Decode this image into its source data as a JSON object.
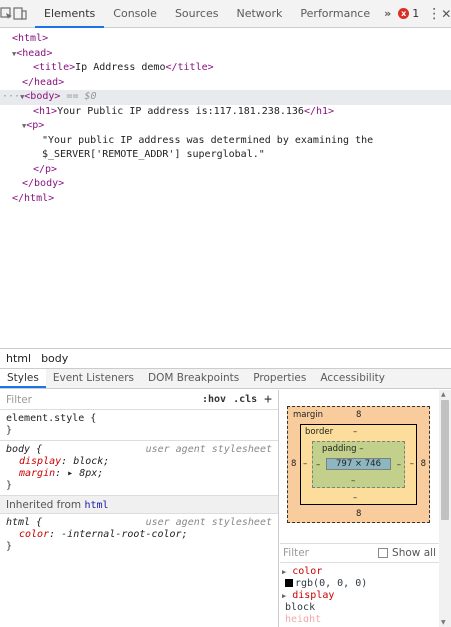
{
  "toolbar": {
    "tabs": [
      "Elements",
      "Console",
      "Sources",
      "Network",
      "Performance"
    ],
    "more": "»",
    "error_count": "1",
    "error_glyph": "x",
    "kebab": "⋮",
    "close": "✕"
  },
  "dom": {
    "html_open": "<html>",
    "head_open": "<head>",
    "title_open": "<title>",
    "title_text": "Ip Address demo",
    "title_close": "</title>",
    "head_close": "</head>",
    "body_open": "<body>",
    "body_marker": " == $0",
    "h1_open": "<h1>",
    "h1_text": "Your Public IP address is:117.181.238.136",
    "h1_close": "</h1>",
    "p_open": "<p>",
    "p_text_1": "\"Your public IP address was determined by examining the",
    "p_text_2": "$_SERVER['REMOTE_ADDR'] superglobal.\"",
    "p_close": "</p>",
    "body_close": "</body>",
    "html_close": "</html>"
  },
  "breadcrumb": [
    "html",
    "body"
  ],
  "side_tabs": [
    "Styles",
    "Event Listeners",
    "DOM Breakpoints",
    "Properties",
    "Accessibility"
  ],
  "styles": {
    "filter_placeholder": "Filter",
    "hov": ":hov",
    "cls": ".cls",
    "plus": "+",
    "element_style": "element.style {",
    "close_brace": "}",
    "body_selector": "body {",
    "user_agent": "user agent stylesheet",
    "display_name": "display",
    "display_value": "block;",
    "margin_name": "margin",
    "margin_value": "▸ 8px;",
    "inherited_label": "Inherited from",
    "inherited_link": "html",
    "html_selector": "html {",
    "color_name": "color",
    "color_value": "-internal-root-color;"
  },
  "box_model": {
    "margin_label": "margin",
    "margin_top": "8",
    "margin_bottom": "8",
    "margin_left": "8",
    "margin_right": "8",
    "border_label": "border",
    "border_top": "–",
    "border_bottom": "–",
    "border_left": "–",
    "border_right": "–",
    "padding_label": "padding –",
    "padding_bottom": "–",
    "padding_left": "–",
    "padding_right": "–",
    "content": "797 × 746"
  },
  "computed": {
    "filter_placeholder": "Filter",
    "show_all": "Show all",
    "color_name": "color",
    "color_value": "rgb(0, 0, 0)",
    "display_name": "display",
    "display_value": "block",
    "height_name": "height"
  }
}
